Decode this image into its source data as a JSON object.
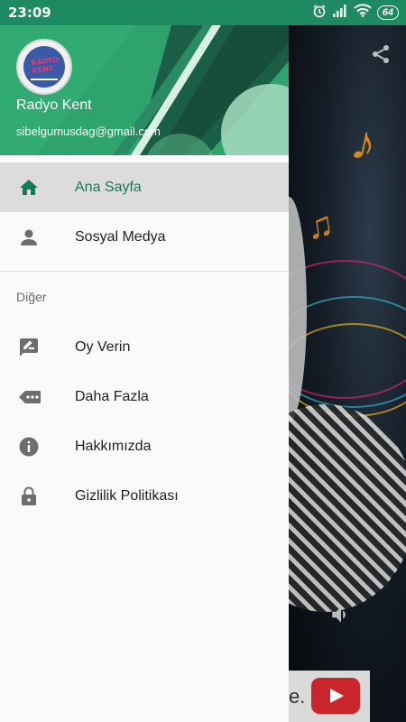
{
  "status_bar": {
    "time": "23:09",
    "battery": "64"
  },
  "drawer": {
    "user_name": "Radyo Kent",
    "user_email": "sibelgumusdag@gmail.com",
    "logo_text": "RADYO KENT",
    "items": [
      {
        "label": "Ana Sayfa",
        "icon": "home-icon",
        "active": true
      },
      {
        "label": "Sosyal Medya",
        "icon": "person-icon",
        "active": false
      }
    ],
    "section_title": "Diğer",
    "other_items": [
      {
        "label": "Oy Verin",
        "icon": "rate-review-icon"
      },
      {
        "label": "Daha Fazla",
        "icon": "more-icon"
      },
      {
        "label": "Hakkımızda",
        "icon": "info-icon"
      },
      {
        "label": "Gizlilik Politikası",
        "icon": "lock-icon"
      }
    ]
  },
  "background": {
    "ad_text": "e."
  },
  "colors": {
    "accent": "#137a5c",
    "header": "#2ea36d",
    "status_bar": "#1e8a62"
  }
}
